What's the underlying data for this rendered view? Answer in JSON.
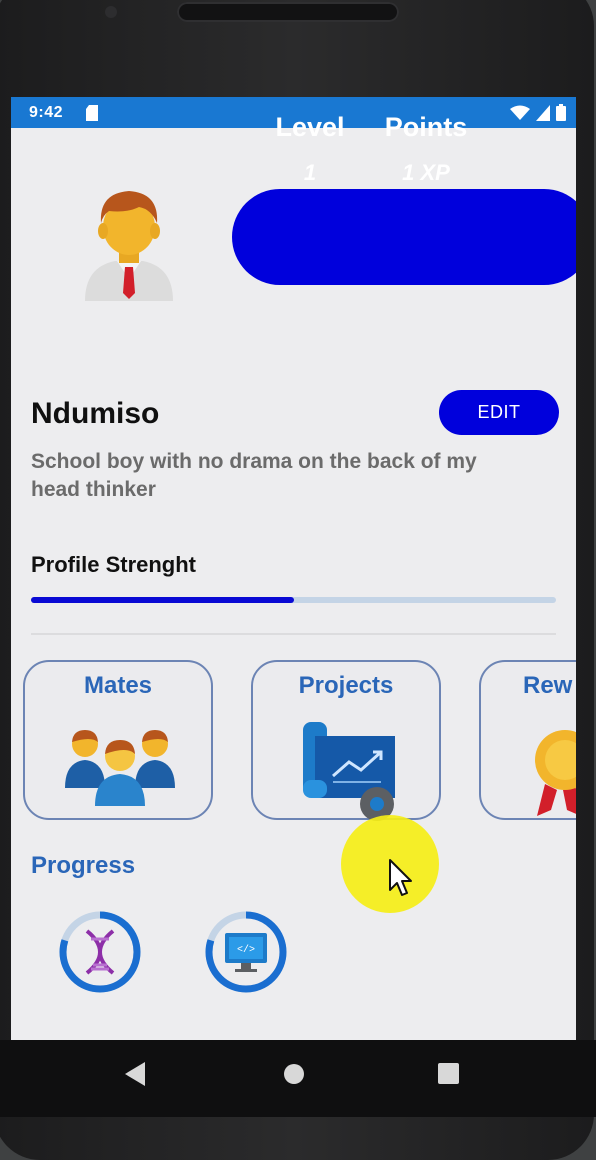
{
  "status_bar": {
    "time": "9:42"
  },
  "profile": {
    "level_label": "Level",
    "level_value": "1",
    "points_label": "Points",
    "points_value": "1 XP",
    "name": "Ndumiso",
    "edit_label": "EDIT",
    "bio": "School boy with no drama on the back of my head thinker",
    "strength_label": "Profile Strenght",
    "strength_fraction": 0.5
  },
  "cards": [
    {
      "title": "Mates",
      "icon": "people-group-icon"
    },
    {
      "title": "Projects",
      "icon": "project-blueprint-icon"
    },
    {
      "title": "Rew",
      "icon": "award-medal-icon"
    }
  ],
  "progress": {
    "title": "Progress",
    "items": [
      {
        "icon": "dna-icon",
        "fraction": 0.8
      },
      {
        "icon": "code-monitor-icon",
        "fraction": 0.8
      }
    ]
  },
  "colors": {
    "status_bar": "#1978d2",
    "accent": "#0000dc",
    "card_title": "#2a66b8",
    "screen_bg": "#ededef"
  },
  "nav": {
    "icons": [
      "back-icon",
      "home-icon",
      "recents-icon"
    ]
  }
}
